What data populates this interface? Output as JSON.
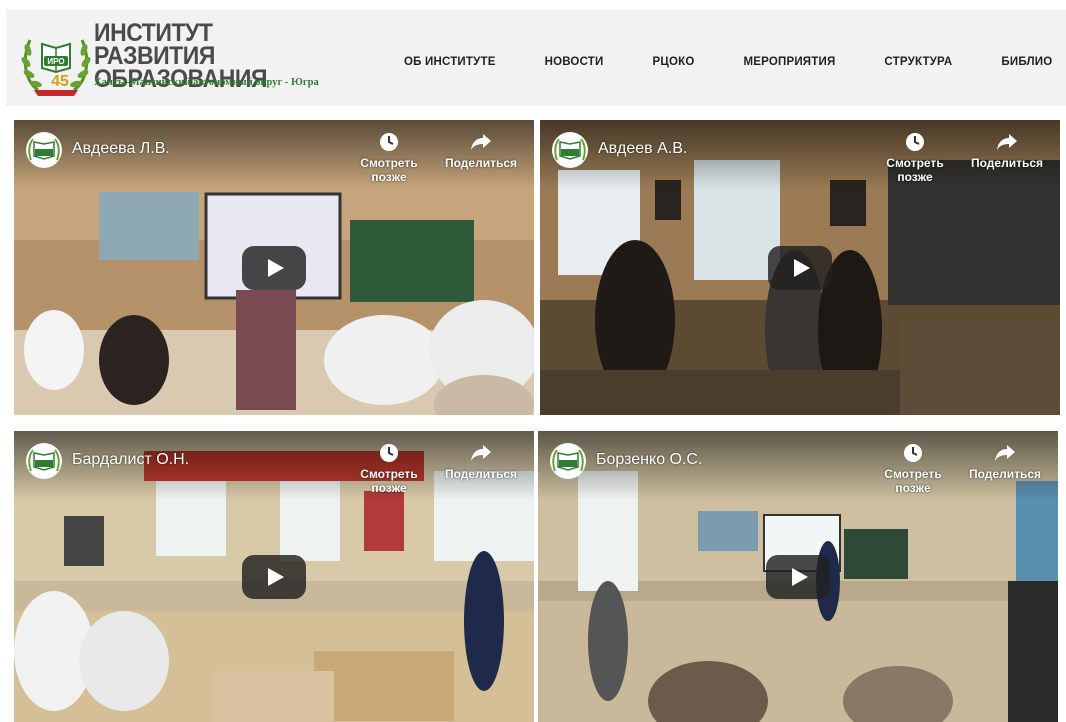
{
  "site": {
    "title_line1": "ИНСТИТУТ РАЗВИТИЯ",
    "title_line2": "ОБРАЗОВАНИЯ",
    "subtitle": "Ханты-Мансийский автономный округ - Югра",
    "emblem_text": "ИРО",
    "emblem_number": "45"
  },
  "nav": {
    "items": [
      "ОБ ИНСТИТУТЕ",
      "НОВОСТИ",
      "РЦОКО",
      "МЕРОПРИЯТИЯ",
      "СТРУКТУРА",
      "БИБЛИО"
    ]
  },
  "videos": [
    {
      "title": "Авдеева Л.В.",
      "watch_later": "Смотреть позже",
      "share": "Поделиться"
    },
    {
      "title": "Авдеев А.В.",
      "watch_later": "Смотреть позже",
      "share": "Поделиться"
    },
    {
      "title": "Бардалист О.Н.",
      "watch_later": "Смотреть позже",
      "share": "Поделиться"
    },
    {
      "title": "Борзенко О.С.",
      "watch_later": "Смотреть позже",
      "share": "Поделиться"
    }
  ],
  "colors": {
    "brand_green": "#2e7d32",
    "title_gray": "#4a4a4a",
    "header_bg": "#f2f2f2"
  }
}
